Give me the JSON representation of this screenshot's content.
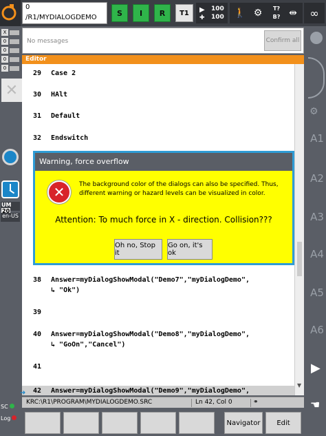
{
  "topbar": {
    "robot_index": "0",
    "robot_path": "/R1/MYDIALOGDEMO",
    "status_s": "S",
    "status_i": "I",
    "status_r": "R",
    "mode": "T1",
    "override_prog": "100",
    "override_jog": "100",
    "tool_label": "T?",
    "base_label": "B?",
    "infinity": "∞",
    "status_color": "#2fb44a"
  },
  "left": {
    "rows": [
      {
        "key": "X"
      },
      {
        "key": "0"
      },
      {
        "key": "0"
      },
      {
        "key": "0"
      },
      {
        "key": "0"
      },
      {
        "key": "0"
      }
    ],
    "um_label": "UM",
    "um_value": "20",
    "lang": "en-US",
    "sc": "SC",
    "log": "Log"
  },
  "right": {
    "axes": [
      "A1",
      "A2",
      "A3",
      "A4",
      "A5",
      "A6"
    ]
  },
  "messages": {
    "text": "No messages",
    "confirm_all": "Confirm all"
  },
  "editor": {
    "title": "Editor",
    "accent": "#f2901b",
    "lines": [
      {
        "num": "29",
        "code": "Case 2"
      },
      {
        "num": "30",
        "code": "HAlt"
      },
      {
        "num": "31",
        "code": "Default"
      },
      {
        "num": "32",
        "code": "Endswitch"
      },
      {
        "num": "38",
        "code": "Answer=myDialogShowModal(\"Demo7\",\"myDialogDemo\",",
        "cont": "\"Ok\")"
      },
      {
        "num": "39",
        "code": ""
      },
      {
        "num": "40",
        "code": "Answer=myDialogShowModal(\"Demo8\",\"myDialogDemo\",",
        "cont": "\"GoOn\",\"Cancel\")"
      },
      {
        "num": "41",
        "code": ""
      },
      {
        "num": "42",
        "code": "Answer=myDialogShowModal(\"Demo9\",\"myDialogDemo\","
      }
    ]
  },
  "status": {
    "path": "KRC:\\R1\\PROGRAM\\MYDIALOGDEMO.SRC",
    "position": "Ln 42, Col 0"
  },
  "bottom": {
    "navigator": "Navigator",
    "edit": "Edit"
  },
  "dialog": {
    "title": "Warning, force overflow",
    "info": "The background color of the dialogs can also be specified. Thus, different warning or hazard levels can be visualized in color.",
    "message": "Attention: To much force in X - direction. Collision???",
    "button1": "Oh no, Stop it",
    "button2": "Go on, it's ok",
    "background": "#ffff00",
    "icon": "error-icon"
  }
}
